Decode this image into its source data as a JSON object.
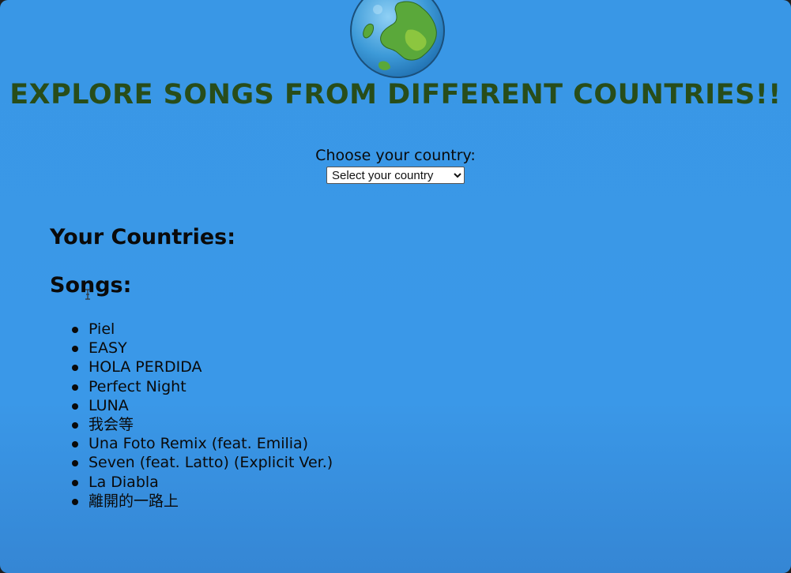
{
  "header": {
    "title": "EXPLORE SONGS FROM DIFFERENT COUNTRIES!!"
  },
  "chooser": {
    "label": "Choose your country:",
    "selected": "Select your country"
  },
  "sections": {
    "countries_heading": "Your Countries:",
    "songs_heading": "Songs:"
  },
  "songs": [
    "Piel",
    "EASY",
    "HOLA PERDIDA",
    "Perfect Night",
    "LUNA",
    "我会等",
    "Una Foto Remix (feat. Emilia)",
    "Seven (feat. Latto) (Explicit Ver.)",
    "La Diabla",
    "離開的一路上"
  ],
  "icons": {
    "logo": "globe-icon",
    "pointer": "text-cursor-icon"
  },
  "colors": {
    "background": "#3a98e8",
    "title": "#284d1a",
    "text": "#0a0a0a"
  }
}
